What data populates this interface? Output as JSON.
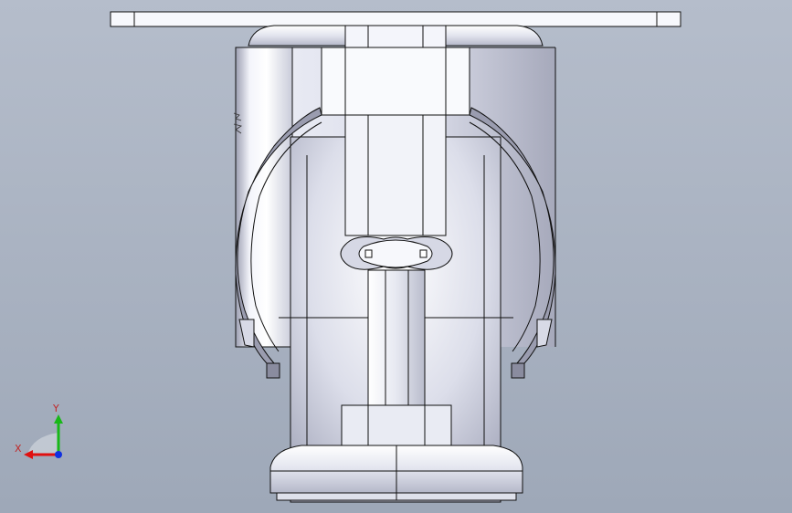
{
  "triad": {
    "x_label": "X",
    "y_label": "Y",
    "x_color": "#e01010",
    "y_color": "#18b818",
    "z_color": "#1030e0",
    "label_color": "#c02828"
  },
  "colors": {
    "background_top": "#b5bdcb",
    "background_bottom": "#9ea8b8",
    "part_light": "#f6f7fc",
    "part_mid": "#d4d6e4",
    "part_dark": "#8e91a4",
    "edge": "#101010"
  }
}
